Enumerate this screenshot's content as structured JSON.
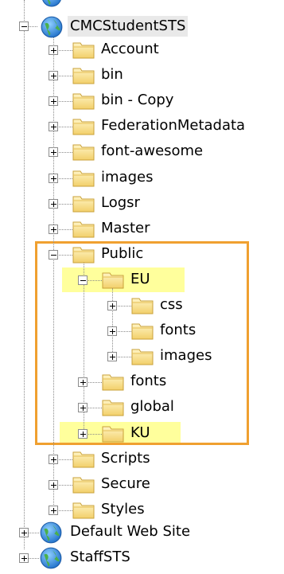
{
  "tree": {
    "top_partial": {
      "name": "partial-site-icon"
    },
    "site_cmc": {
      "label": "CMCStudentSTS"
    },
    "children": [
      {
        "label": "Account"
      },
      {
        "label": "bin"
      },
      {
        "label": "bin - Copy"
      },
      {
        "label": "FederationMetadata"
      },
      {
        "label": "font-awesome"
      },
      {
        "label": "images"
      },
      {
        "label": "Logsr"
      },
      {
        "label": "Master"
      },
      {
        "label": "Public"
      },
      {
        "label": "Scripts"
      },
      {
        "label": "Secure"
      },
      {
        "label": "Styles"
      }
    ],
    "public_children": [
      {
        "label": "EU"
      },
      {
        "label": "fonts"
      },
      {
        "label": "global"
      },
      {
        "label": "KU"
      }
    ],
    "eu_children": [
      {
        "label": "css"
      },
      {
        "label": "fonts"
      },
      {
        "label": "images"
      }
    ],
    "sites": [
      {
        "label": "Default Web Site"
      },
      {
        "label": "StaffSTS"
      }
    ]
  },
  "colors": {
    "highlight_fill": "#ffff9c",
    "highlight_box": "#f0a030",
    "folder": "#f5d778"
  }
}
